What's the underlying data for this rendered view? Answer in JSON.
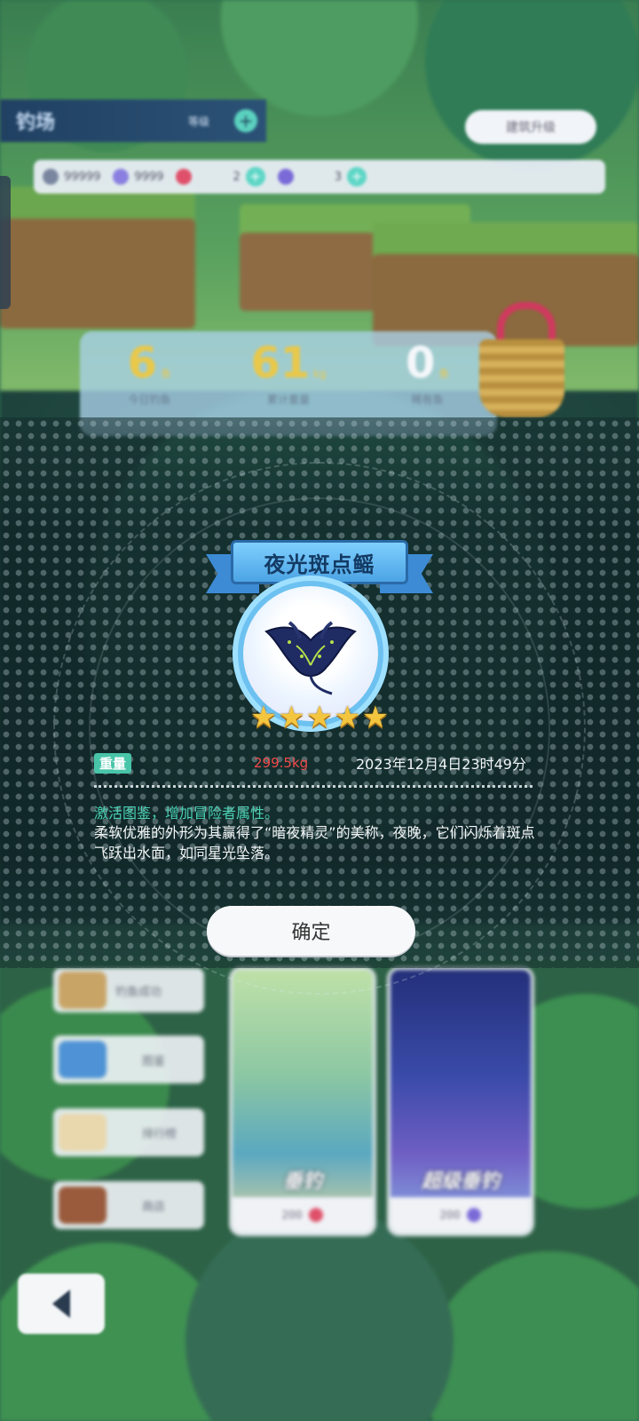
{
  "background": {
    "topbar": {
      "title": "钓场",
      "level": "等级",
      "plus": "+"
    },
    "build_button": "建筑升级",
    "resources": [
      {
        "value": "99999",
        "color": "#7a86a0"
      },
      {
        "value": "9999",
        "color": "#8a7fe0"
      },
      {
        "value": "2",
        "color": "#e0506a"
      },
      {
        "value": "3",
        "color": "#7a6ad8"
      }
    ],
    "stats": [
      {
        "number": "6",
        "unit": "条",
        "label": "今日钓鱼"
      },
      {
        "number": "61",
        "unit": "kg",
        "label": "累计重量"
      },
      {
        "number": "0",
        "unit": "条",
        "label": "稀有鱼"
      }
    ],
    "side_menu": [
      "钓鱼成功",
      "图鉴",
      "排行榜",
      "商店"
    ],
    "cards": [
      {
        "label": "垂钓",
        "price": "200"
      },
      {
        "label": "超级垂钓",
        "price": "200"
      }
    ]
  },
  "popup": {
    "fish_name": "夜光斑点鳐",
    "stars": [
      "★",
      "★",
      "★",
      "★",
      "★"
    ],
    "weight_label": "重量",
    "weight_value": "299.5kg",
    "date": "2023年12月4日23时49分",
    "activate_text": "激活图鉴，增加冒险者属性。",
    "description": "柔软优雅的外形为其赢得了“暗夜精灵”的美称，夜晚，它们闪烁着斑点飞跃出水面，如同星光坠落。",
    "confirm_label": "确定"
  },
  "colors": {
    "accent_teal": "#48c5a9",
    "weight_red": "#f24a4a",
    "ribbon_blue": "#4ca4e4",
    "star_gold": "#f4c63f"
  }
}
